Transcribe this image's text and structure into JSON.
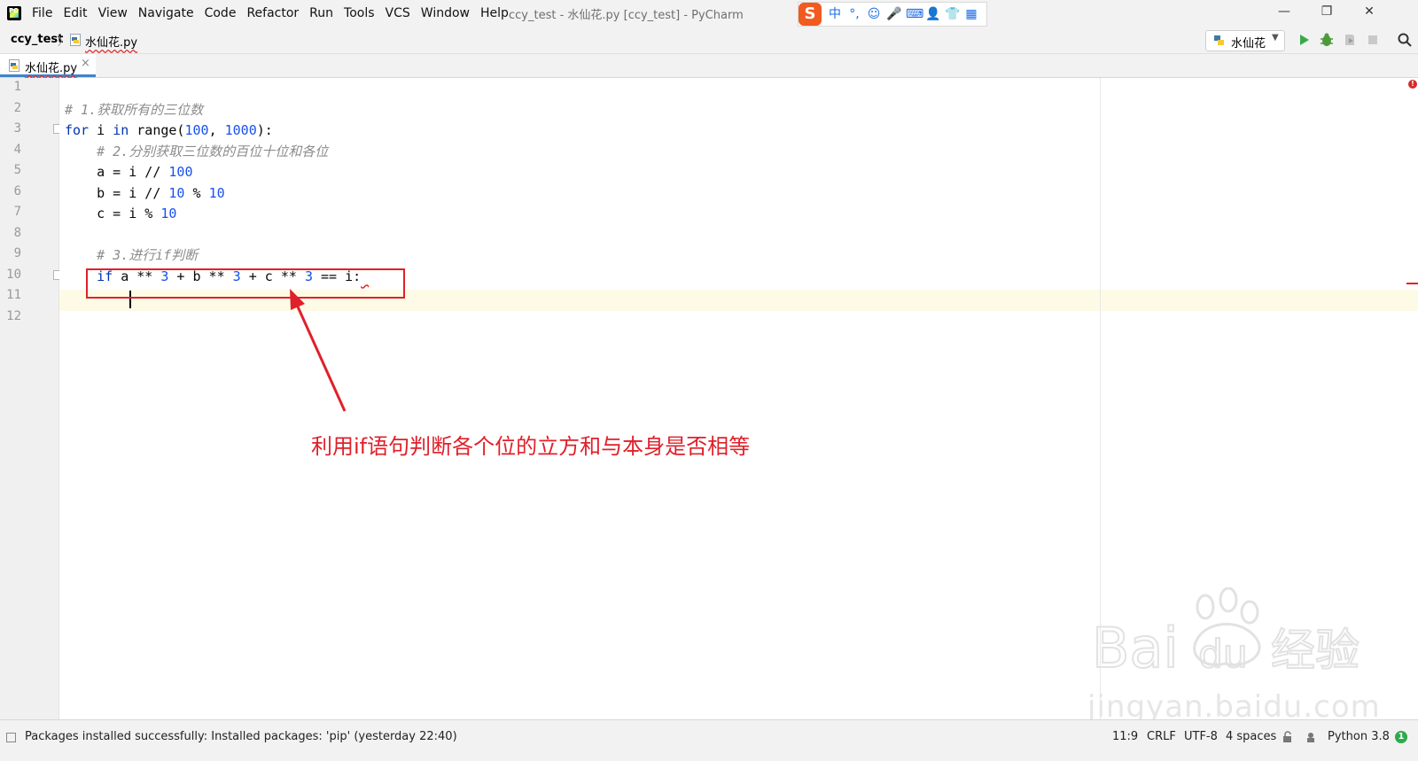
{
  "window": {
    "title": "ccy_test - 水仙花.py [ccy_test] - PyCharm",
    "app_logo_text": "PC"
  },
  "menu": [
    "File",
    "Edit",
    "View",
    "Navigate",
    "Code",
    "Refactor",
    "Run",
    "Tools",
    "VCS",
    "Window",
    "Help"
  ],
  "ime": {
    "logo": "S",
    "items": [
      "中",
      "°,",
      "☺",
      "🎤",
      "⌨",
      "👤",
      "👕",
      "▦"
    ]
  },
  "window_controls": {
    "minimize": "—",
    "restore": "❐",
    "close": "✕"
  },
  "navbar": {
    "project": "ccy_test",
    "separator": "〉",
    "file": "水仙花.py",
    "run_config": "水仙花",
    "run_config_arrow": "▼"
  },
  "tab": {
    "label": "水仙花.py",
    "close": "×"
  },
  "editor": {
    "line_numbers": [
      "1",
      "2",
      "3",
      "4",
      "5",
      "6",
      "7",
      "8",
      "9",
      "10",
      "11",
      "12"
    ],
    "lines": [
      {
        "tokens": []
      },
      {
        "tokens": [
          {
            "t": "# 1.获取所有的三位数",
            "c": "cmt"
          }
        ]
      },
      {
        "tokens": [
          {
            "t": "for",
            "c": "kw"
          },
          {
            "t": " i ",
            "c": ""
          },
          {
            "t": "in",
            "c": "kw"
          },
          {
            "t": " range(",
            "c": ""
          },
          {
            "t": "100",
            "c": "num"
          },
          {
            "t": ", ",
            "c": ""
          },
          {
            "t": "1000",
            "c": "num"
          },
          {
            "t": "):",
            "c": ""
          }
        ]
      },
      {
        "tokens": [
          {
            "t": "    ",
            "c": ""
          },
          {
            "t": "# 2.分别获取三位数的百位十位和各位",
            "c": "cmt"
          }
        ]
      },
      {
        "tokens": [
          {
            "t": "    a = i // ",
            "c": ""
          },
          {
            "t": "100",
            "c": "num"
          }
        ]
      },
      {
        "tokens": [
          {
            "t": "    b = i // ",
            "c": ""
          },
          {
            "t": "10",
            "c": "num"
          },
          {
            "t": " % ",
            "c": ""
          },
          {
            "t": "10",
            "c": "num"
          }
        ]
      },
      {
        "tokens": [
          {
            "t": "    c = i % ",
            "c": ""
          },
          {
            "t": "10",
            "c": "num"
          }
        ]
      },
      {
        "tokens": []
      },
      {
        "tokens": [
          {
            "t": "    ",
            "c": ""
          },
          {
            "t": "# 3.进行if判断",
            "c": "cmt"
          }
        ]
      },
      {
        "tokens": [
          {
            "t": "    ",
            "c": ""
          },
          {
            "t": "if",
            "c": "kw"
          },
          {
            "t": " a ** ",
            "c": ""
          },
          {
            "t": "3",
            "c": "num"
          },
          {
            "t": " + b ** ",
            "c": ""
          },
          {
            "t": "3",
            "c": "num"
          },
          {
            "t": " + c ** ",
            "c": ""
          },
          {
            "t": "3",
            "c": "num"
          },
          {
            "t": " == i:",
            "c": ""
          },
          {
            "t": " ",
            "c": "squiggle"
          }
        ]
      },
      {
        "tokens": []
      },
      {
        "tokens": []
      }
    ],
    "error_icon": "!"
  },
  "annotation": {
    "text": "利用if语句判断各个位的立方和与本身是否相等",
    "color": "#e0202a"
  },
  "watermark": {
    "logo_text": "Bai du 经验",
    "url": "jingyan.baidu.com"
  },
  "statusbar": {
    "message": "Packages installed successfully: Installed packages: 'pip' (yesterday 22:40)",
    "position": "11:9",
    "line_separator": "CRLF",
    "encoding": "UTF-8",
    "indent": "4 spaces",
    "interpreter": "Python 3.8",
    "event_count": "1"
  }
}
